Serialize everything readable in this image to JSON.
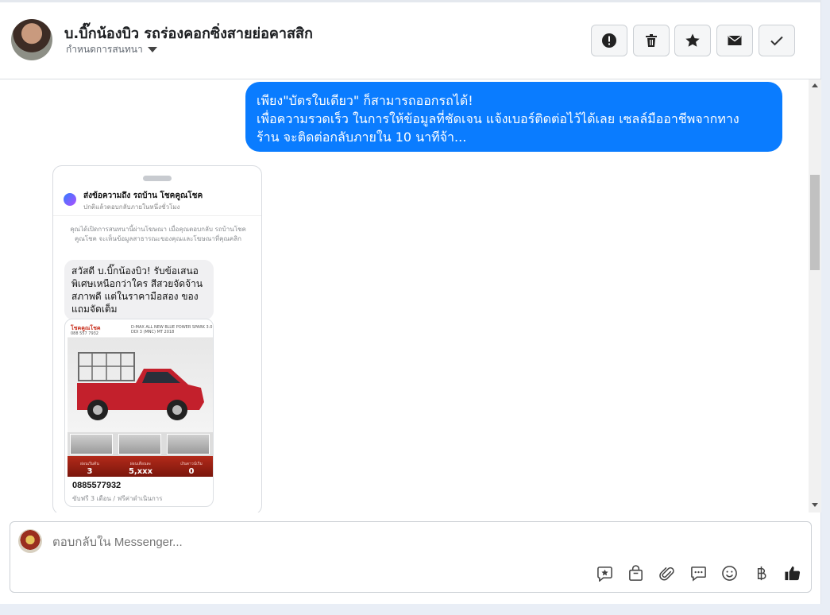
{
  "header": {
    "name": "บ.บิ๊กน้องบิว รถร่องคอกซิ่งสายย่อคาสสิก",
    "subtitle": "กำหนดการสนทนา"
  },
  "toolbar": [
    {
      "name": "alert-icon"
    },
    {
      "name": "trash-icon"
    },
    {
      "name": "star-icon"
    },
    {
      "name": "mail-icon"
    },
    {
      "name": "check-icon"
    }
  ],
  "message": {
    "line1": "เพียง\"บัตรใบเดียว\" ก็สามารถออกรถได้!",
    "line2": "เพื่อความรวดเร็ว ในการให้ข้อมูลที่ชัดเจน แจ้งเบอร์ติดต่อไว้ได้เลย เซลล์มืออาชีพจากทาง",
    "line3": "ร้าน จะติดต่อกลับภายใน 10 นาทีจ้า..."
  },
  "preview": {
    "title": "ส่งข้อความถึง รถบ้าน โชคคูณโชค",
    "subtitle": "ปกติแล้วตอบกลับภายในหนึ่งชั่วโมง",
    "info": "คุณได้เปิดการสนทนานี้ผ่านโฆษณา เมื่อคุณตอบกลับ รถบ้านโชคคูณโชค จะเห็นข้อมูลสาธารณะของคุณและโฆษณาที่คุณคลิก",
    "greeting": "สวัสดี บ.บิ๊กน้องบิว! รับข้อเสนอพิเศษเหนือกว่าใคร สีสวยจัดจ้าน สภาพดี แต่ในราคามือสอง ของแถมจัดเต็ม",
    "ad_logo": "โชคคูณโชค",
    "ad_headline": "D-MAX ALL NEW BLUE POWER SPARK 3.0 DDI 3 (MNC) MT 2018",
    "ad_phone": "088 557 7932",
    "stats": [
      {
        "label": "ผ่อนเริ่มต้น",
        "value": "3"
      },
      {
        "label": "ผ่อนเดือนละ",
        "value": "5,xxx"
      },
      {
        "label": "เงินดาวน์เริ่ม",
        "value": "0"
      }
    ],
    "phone": "0885577932",
    "card_subtitle": "ขับฟรี 3 เดือน / ฟรีค่าดำเนินการ"
  },
  "composer": {
    "placeholder": "ตอบกลับใน Messenger...",
    "icons": [
      "sticker-star-icon",
      "shopping-bag-icon",
      "attachment-icon",
      "message-template-icon",
      "emoji-icon",
      "baht-icon",
      "thumbs-up-icon"
    ]
  },
  "colors": {
    "accent": "#0a7cff",
    "background": "#e9eef6"
  }
}
